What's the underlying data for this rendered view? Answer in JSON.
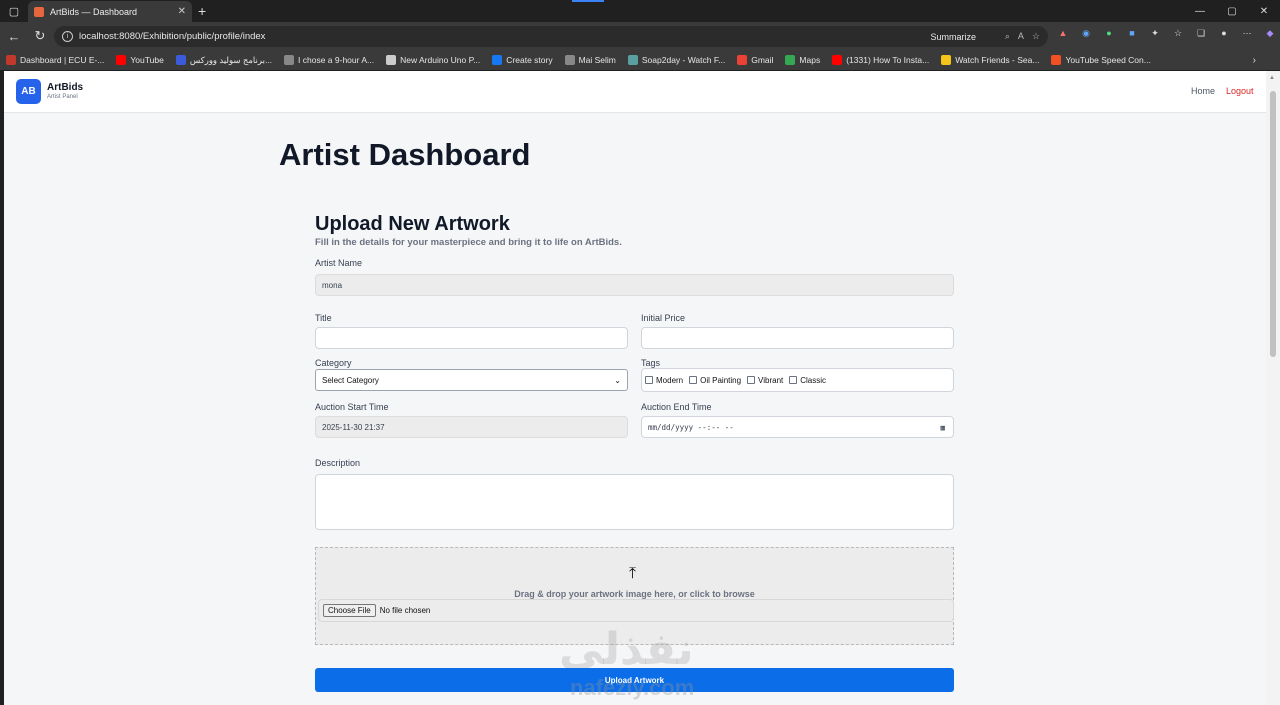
{
  "browser": {
    "tab_title": "ArtBids — Dashboard",
    "url": "localhost:8080/Exhibition/public/profile/index",
    "summarize": "Summarize",
    "bookmarks": [
      {
        "label": "Dashboard | ECU E-...",
        "color": "#c0392b"
      },
      {
        "label": "YouTube",
        "color": "#ff0000"
      },
      {
        "label": "برنامج سوليد ووركس...",
        "color": "#3b5bdb"
      },
      {
        "label": "I chose a 9-hour A...",
        "color": "#888888"
      },
      {
        "label": "New Arduino Uno P...",
        "color": "#cccccc"
      },
      {
        "label": "Create story",
        "color": "#1877f2"
      },
      {
        "label": "Mai Selim",
        "color": "#888888"
      },
      {
        "label": "Soap2day - Watch F...",
        "color": "#5aa0a0"
      },
      {
        "label": "Gmail",
        "color": "#ea4335"
      },
      {
        "label": "Maps",
        "color": "#34a853"
      },
      {
        "label": "(1331) How To Insta...",
        "color": "#ff0000"
      },
      {
        "label": "Watch Friends - Sea...",
        "color": "#f5c518"
      },
      {
        "label": "YouTube Speed Con...",
        "color": "#f25022"
      }
    ]
  },
  "app": {
    "logo": "AB",
    "brand": "ArtBids",
    "brand_sub": "Artist Panel",
    "nav_home": "Home",
    "nav_logout": "Logout"
  },
  "page": {
    "title": "Artist Dashboard",
    "form_title": "Upload New Artwork",
    "form_subtitle": "Fill in the details for your masterpiece and bring it to life on ArtBids."
  },
  "form": {
    "artist_name_label": "Artist Name",
    "artist_name_value": "mona",
    "title_label": "Title",
    "title_value": "",
    "price_label": "Initial Price",
    "price_value": "",
    "category_label": "Category",
    "category_selected": "Select Category",
    "tags_label": "Tags",
    "tags": [
      "Modern",
      "Oil Painting",
      "Vibrant",
      "Classic"
    ],
    "start_label": "Auction Start Time",
    "start_value": "2025-11-30 21:37",
    "end_label": "Auction End Time",
    "end_placeholder": "mm/dd/yyyy --:-- --",
    "description_label": "Description",
    "dropzone_text": "Drag & drop your artwork image here, or click to browse",
    "file_button": "Choose File",
    "file_status": "No file chosen",
    "submit_label": "Upload Artwork"
  },
  "watermark": {
    "arabic": "نفذلي",
    "latin": "nafezly.com"
  },
  "colors": {
    "primary": "#2563eb",
    "submit": "#0b6de8",
    "logout": "#dc2626"
  }
}
